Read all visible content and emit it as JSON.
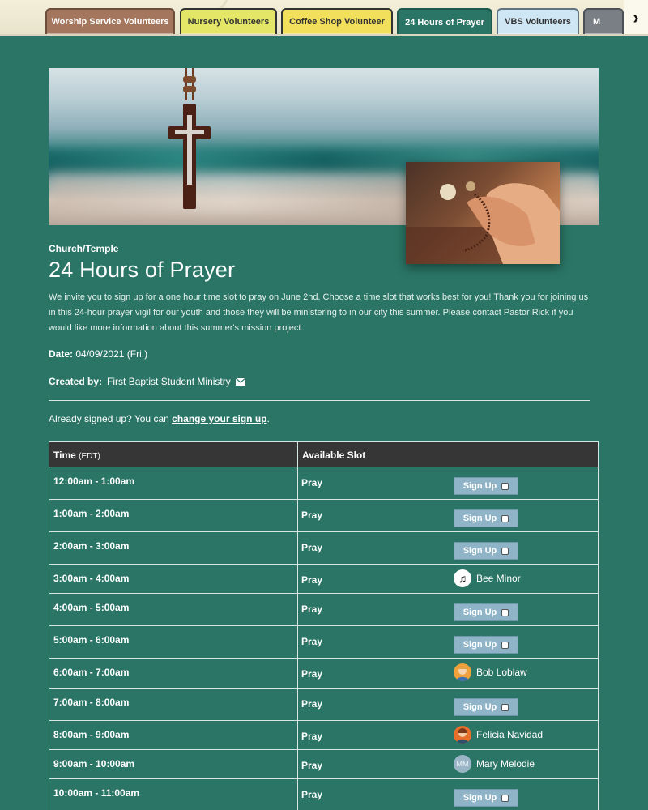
{
  "tabs": [
    {
      "label": "Worship Service Volunteers"
    },
    {
      "label": "Nursery Volunteers"
    },
    {
      "label": "Coffee Shop Volunteer"
    },
    {
      "label": "24 Hours of Prayer"
    },
    {
      "label": "VBS Volunteers"
    },
    {
      "label": "M"
    }
  ],
  "tab_next_icon": "chevron-right-icon",
  "colors": {
    "background": "#2a7566",
    "table_header": "#363636",
    "signup_button": "#8fb3c7"
  },
  "event": {
    "category": "Church/Temple",
    "title": "24 Hours of Prayer",
    "description": "We invite you to sign up for a one hour time slot to pray on June 2nd. Choose a time slot that works best for you! Thank you for joining us in this 24-hour prayer vigil for our youth and those they will be ministering to in our city this summer. Please contact Pastor Rick if you would like more information about this summer's mission project.",
    "date_label": "Date:",
    "date_value": "04/09/2021 (Fri.)",
    "created_by_label": "Created by:",
    "created_by_value": "First Baptist Student Ministry"
  },
  "signed_up": {
    "text": "Already signed up? You can",
    "link": "change your sign up",
    "period": "."
  },
  "table": {
    "col_time": "Time",
    "col_time_tz": "(EDT)",
    "col_slot": "Available Slot",
    "signup_label": "Sign Up",
    "rows": [
      {
        "time": "12:00am - 1:00am",
        "slot": "Pray"
      },
      {
        "time": "1:00am - 2:00am",
        "slot": "Pray"
      },
      {
        "time": "2:00am - 3:00am",
        "slot": "Pray"
      },
      {
        "time": "3:00am - 4:00am",
        "slot": "Pray",
        "person": "Bee Minor"
      },
      {
        "time": "4:00am - 5:00am",
        "slot": "Pray"
      },
      {
        "time": "5:00am - 6:00am",
        "slot": "Pray"
      },
      {
        "time": "6:00am - 7:00am",
        "slot": "Pray",
        "person": "Bob Loblaw"
      },
      {
        "time": "7:00am - 8:00am",
        "slot": "Pray"
      },
      {
        "time": "8:00am - 9:00am",
        "slot": "Pray",
        "person": "Felicia Navidad"
      },
      {
        "time": "9:00am - 10:00am",
        "slot": "Pray",
        "person": "Mary Melodie",
        "initials": "MM"
      },
      {
        "time": "10:00am - 11:00am",
        "slot": "Pray"
      }
    ]
  }
}
